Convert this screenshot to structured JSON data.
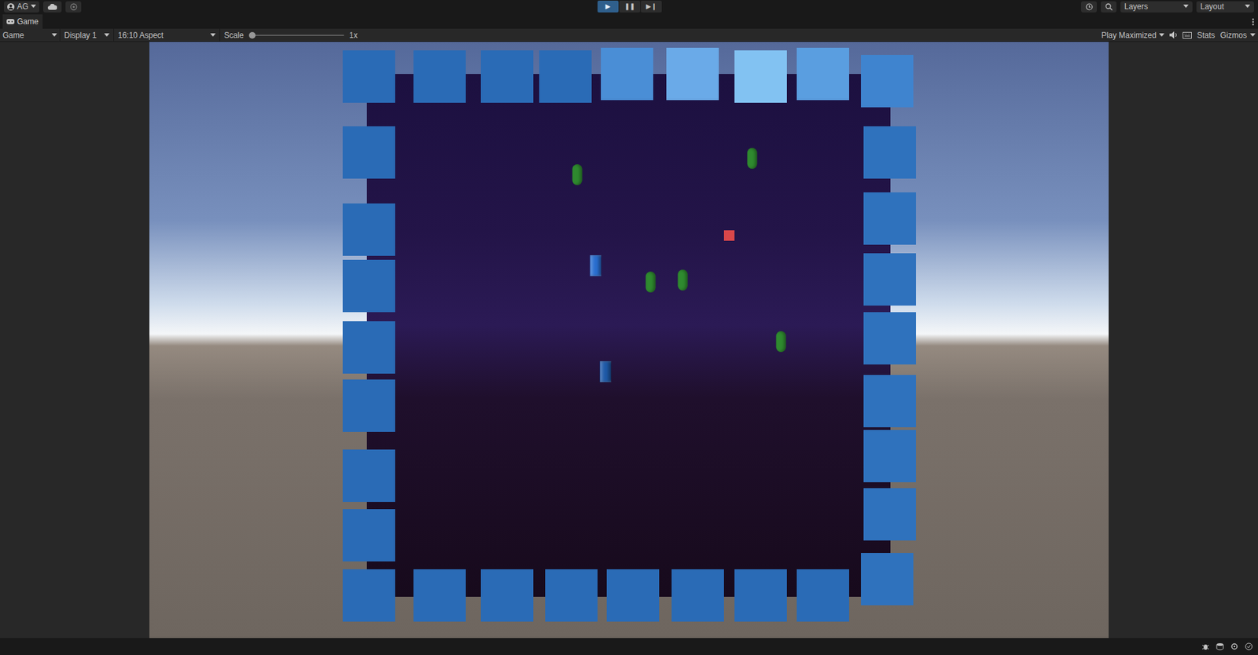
{
  "window": {
    "title": "Game"
  },
  "toolbar": {
    "account": "AG",
    "layers": "Layers",
    "layout": "Layout",
    "playback": [
      {
        "name": "play",
        "label": "▶",
        "selected": true
      },
      {
        "name": "pause",
        "label": "❚❚",
        "selected": false
      },
      {
        "name": "step",
        "label": "▶❙",
        "selected": false
      }
    ]
  },
  "tabs": [
    {
      "label": "Game",
      "selected": true
    }
  ],
  "game_toolbar": {
    "view": "Game",
    "display": "Display 1",
    "aspect": "16:10 Aspect",
    "scale_label": "Scale",
    "scale_value": "1x",
    "scale_level": 0.0,
    "play_mode": "Play Maximized",
    "stats": "Stats",
    "gizmos": "Gizmos"
  },
  "scene": {
    "walls": [
      {
        "color": "#2a6bb6"
      },
      {
        "color": "#2a6bb6"
      },
      {
        "color": "#2a6bb6"
      },
      {
        "color": "#2a6bb6"
      },
      {
        "color": "#4a8ed6"
      },
      {
        "color": "#6aaae8"
      },
      {
        "color": "#82c2f2"
      },
      {
        "color": "#5a9ee0"
      },
      {
        "color": "#3f84cf"
      },
      {
        "color": "#2a6bb6"
      },
      {
        "color": "#2a6bb6"
      },
      {
        "color": "#2a6bb6"
      },
      {
        "color": "#2a6bb6"
      },
      {
        "color": "#2a6bb6"
      },
      {
        "color": "#2a6bb6"
      },
      {
        "color": "#2a6bb6"
      },
      {
        "color": "#2a6bb6"
      },
      {
        "color": "#2f72bd"
      },
      {
        "color": "#2f72bd"
      },
      {
        "color": "#2f72bd"
      },
      {
        "color": "#2f72bd"
      },
      {
        "color": "#2f72bd"
      },
      {
        "color": "#2f72bd"
      },
      {
        "color": "#2f72bd"
      },
      {
        "color": "#2f72bd"
      },
      {
        "color": "#2a6bb6"
      },
      {
        "color": "#2a6bb6"
      },
      {
        "color": "#2a6bb6"
      },
      {
        "color": "#2a6bb6"
      },
      {
        "color": "#2a6bb6"
      },
      {
        "color": "#2a6bb6"
      },
      {
        "color": "#2a6bb6"
      }
    ],
    "entities": [
      {
        "kind": "enemy",
        "color": "#2f8a2f"
      },
      {
        "kind": "enemy",
        "color": "#2f8a2f"
      },
      {
        "kind": "enemy",
        "color": "#2f8a2f"
      },
      {
        "kind": "enemy",
        "color": "#2f8a2f"
      },
      {
        "kind": "enemy",
        "color": "#2f8a2f"
      },
      {
        "kind": "player",
        "color": "#d9474a"
      },
      {
        "kind": "pickup",
        "color": "#2a6fd0"
      },
      {
        "kind": "pickup",
        "color": "#1f5aa8"
      }
    ]
  }
}
